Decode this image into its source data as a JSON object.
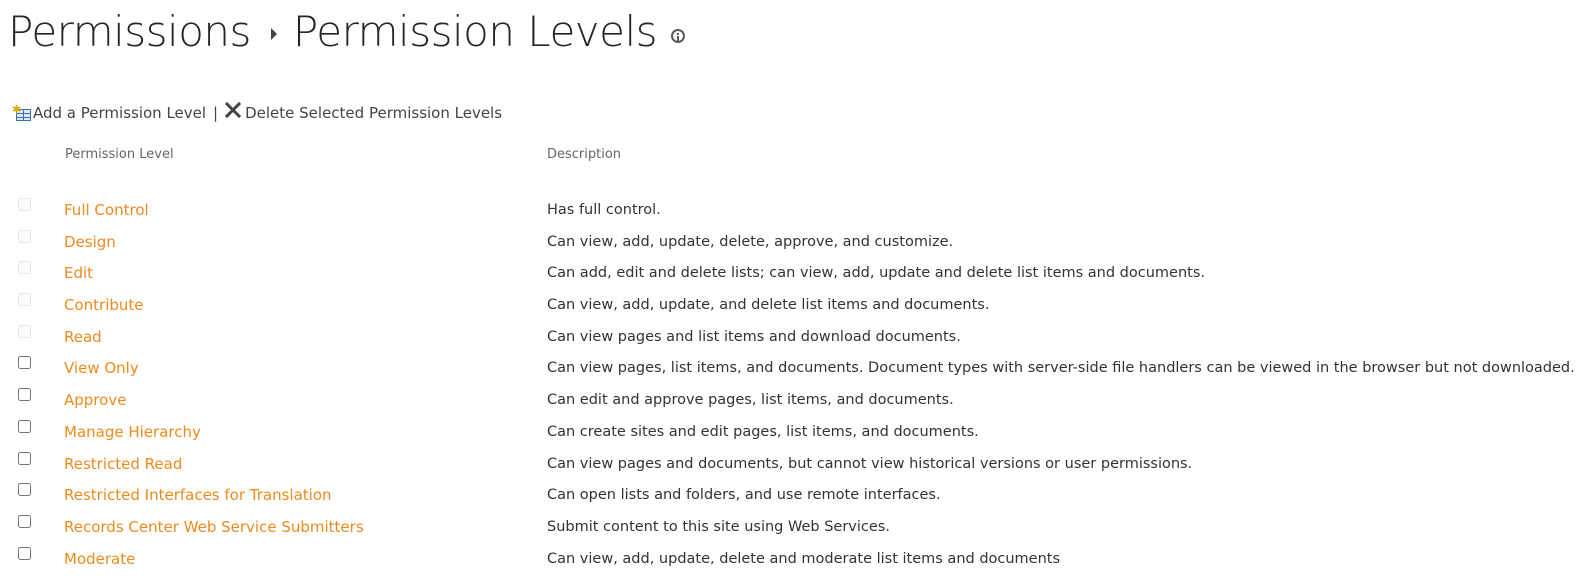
{
  "header": {
    "breadcrumb_root": "Permissions",
    "page_title": "Permission Levels"
  },
  "toolbar": {
    "add_label": "Add a Permission Level",
    "separator": "|",
    "delete_label": "Delete Selected Permission Levels"
  },
  "table": {
    "columns": {
      "level": "Permission Level",
      "description": "Description"
    },
    "rows": [
      {
        "name": "Full Control",
        "description": "Has full control.",
        "checkbox_enabled": false
      },
      {
        "name": "Design",
        "description": "Can view, add, update, delete, approve, and customize.",
        "checkbox_enabled": false
      },
      {
        "name": "Edit",
        "description": "Can add, edit and delete lists; can view, add, update and delete list items and documents.",
        "checkbox_enabled": false
      },
      {
        "name": "Contribute",
        "description": "Can view, add, update, and delete list items and documents.",
        "checkbox_enabled": false
      },
      {
        "name": "Read",
        "description": "Can view pages and list items and download documents.",
        "checkbox_enabled": false
      },
      {
        "name": "View Only",
        "description": "Can view pages, list items, and documents. Document types with server-side file handlers can be viewed in the browser but not downloaded.",
        "checkbox_enabled": true
      },
      {
        "name": "Approve",
        "description": "Can edit and approve pages, list items, and documents.",
        "checkbox_enabled": true
      },
      {
        "name": "Manage Hierarchy",
        "description": "Can create sites and edit pages, list items, and documents.",
        "checkbox_enabled": true
      },
      {
        "name": "Restricted Read",
        "description": "Can view pages and documents, but cannot view historical versions or user permissions.",
        "checkbox_enabled": true
      },
      {
        "name": "Restricted Interfaces for Translation",
        "description": "Can open lists and folders, and use remote interfaces.",
        "checkbox_enabled": true
      },
      {
        "name": "Records Center Web Service Submitters",
        "description": "Submit content to this site using Web Services.",
        "checkbox_enabled": true
      },
      {
        "name": "Moderate",
        "description": "Can view, add, update, delete and moderate list items and documents",
        "checkbox_enabled": true
      }
    ]
  },
  "colors": {
    "link_orange": "#ee8a1e",
    "title_text": "#262626",
    "body_text": "#333333",
    "header_text": "#666666"
  },
  "icons": {
    "info": "info-icon",
    "add": "add-permission-level-icon",
    "delete": "delete-x-icon"
  }
}
